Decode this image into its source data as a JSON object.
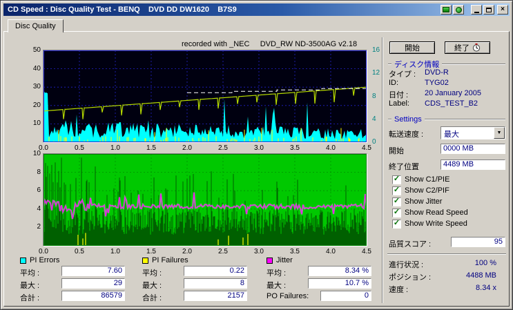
{
  "window": {
    "title": "CD Speed : Disc Quality Test - BENQ    DVD DD DW1620    B7S9"
  },
  "icons": {
    "close": "×",
    "dropdown_arrow": "▼"
  },
  "tabs": {
    "disc_quality": "Disc Quality"
  },
  "header": {
    "recorded_with": "recorded with _NEC     DVD_RW ND-3500AG v2.18",
    "start_button": "開始",
    "stop_button": "終了"
  },
  "disc_info": {
    "title": "ディスク情報",
    "type_label": "タイプ :",
    "type_value": "DVD-R",
    "id_label": "ID:",
    "id_value": "TYG02",
    "date_label": "日付 :",
    "date_value": "20 January 2005",
    "label_label": "Label:",
    "label_value": "CDS_TEST_B2"
  },
  "settings": {
    "title": "Settings",
    "speed_label": "転送速度 :",
    "speed_value": "最大",
    "start_label": "開始",
    "start_value": "0000 MB",
    "end_label": "終了位置",
    "end_value": "4489 MB",
    "checkboxes": [
      {
        "label": "Show C1/PIE",
        "check": "✓"
      },
      {
        "label": "Show C2/PIF",
        "check": "✓"
      },
      {
        "label": "Show Jitter",
        "check": "✓"
      },
      {
        "label": "Show Read Speed",
        "check": "✓"
      },
      {
        "label": "Show Write Speed",
        "check": "✓"
      }
    ],
    "score_label": "品質スコア :",
    "score_value": "95"
  },
  "status": {
    "progress_label": "進行状況 :",
    "progress_value": "100 %",
    "position_label": "ポジション :",
    "position_value": "4488 MB",
    "speed_label": "速度 :",
    "speed_value": "8.34 x"
  },
  "legend": {
    "pi_errors": {
      "name": "PI Errors",
      "color": "#00FFFF",
      "avg_label": "平均 :",
      "avg": "7.60",
      "max_label": "最大 :",
      "max": "29",
      "total_label": "合計 :",
      "total": "86579"
    },
    "pi_failures": {
      "name": "PI Failures",
      "color": "#FFFF00",
      "avg_label": "平均 :",
      "avg": "0.22",
      "max_label": "最大 :",
      "max": "8",
      "total_label": "合計 :",
      "total": "2157"
    },
    "jitter": {
      "name": "Jitter",
      "color": "#FF00FF",
      "avg_label": "平均 :",
      "avg": "8.34 %",
      "max_label": "最大 :",
      "max": "10.7 %",
      "total_label": "PO Failures:",
      "total": "0"
    }
  },
  "chart_data": [
    {
      "type": "area",
      "name": "pi-errors-and-speed",
      "x_range": [
        0,
        4.5
      ],
      "x_ticks": [
        "0.0",
        "0.5",
        "1.0",
        "1.5",
        "2.0",
        "2.5",
        "3.0",
        "3.5",
        "4.0",
        "4.5"
      ],
      "y_left_ticks": [
        "50",
        "40",
        "30",
        "20",
        "10"
      ],
      "y_left_max": 50,
      "y_right_ticks": [
        "16",
        "12",
        "8",
        "4",
        "0"
      ],
      "y_right_max": 16,
      "bg_color": "#000010",
      "grid_color": "#2222CC",
      "series": [
        {
          "name": "PI Errors",
          "type": "area",
          "color": "#00FFFF",
          "avg": 7.6,
          "max": 29
        },
        {
          "name": "PI Failures",
          "type": "spikes",
          "color": "#FFFF00",
          "avg": 0.22,
          "max": 8
        },
        {
          "name": "Write Speed",
          "type": "line",
          "color": "#B8DC00",
          "start_value": 17,
          "end_value": 30
        },
        {
          "name": "Read Speed",
          "type": "step-line",
          "color": "#FFFFFF",
          "start_value": 27,
          "end_value": 30,
          "start_x": 2.0
        }
      ]
    },
    {
      "type": "spikes",
      "name": "pif-density-and-jitter",
      "x_range": [
        0,
        4.5
      ],
      "x_ticks": [
        "0.0",
        "0.5",
        "1.0",
        "1.5",
        "2.0",
        "2.5",
        "3.0",
        "3.5",
        "4.0",
        "4.5"
      ],
      "y_left_ticks": [
        "10",
        "8",
        "6",
        "4",
        "2"
      ],
      "y_left_max": 10,
      "bg_color": "#00C800",
      "grid_color": "#009000",
      "series": [
        {
          "name": "PIF density",
          "type": "spikes",
          "color": "#006000"
        },
        {
          "name": "Jitter",
          "type": "line",
          "color": "#FF00FF",
          "avg": 8.34,
          "max": 10.7,
          "display_baseline": 4.3
        },
        {
          "name": "PI Failure markers",
          "type": "spikes",
          "color": "#FFFF00"
        }
      ]
    }
  ]
}
